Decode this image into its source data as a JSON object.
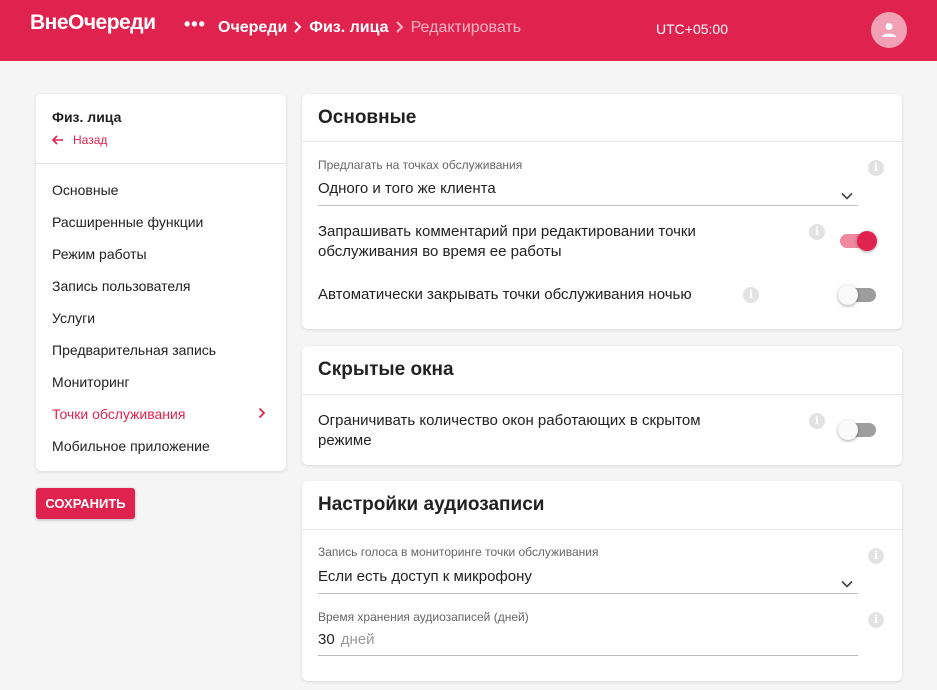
{
  "header": {
    "logo": "ВнеОчереди",
    "more_icon": "•••",
    "breadcrumbs": [
      "Очереди",
      "Физ. лица",
      "Редактировать"
    ],
    "timezone": "UTC+05:00",
    "accent_color": "#e0234e"
  },
  "sidebar": {
    "title": "Физ. лица",
    "back_label": "Назад",
    "items": [
      {
        "label": "Основные"
      },
      {
        "label": "Расширенные функции"
      },
      {
        "label": "Режим работы"
      },
      {
        "label": "Запись пользователя"
      },
      {
        "label": "Услуги"
      },
      {
        "label": "Предварительная запись"
      },
      {
        "label": "Мониторинг"
      },
      {
        "label": "Точки обслуживания",
        "active": true
      },
      {
        "label": "Мобильное приложение"
      }
    ],
    "save_label": "СОХРАНИТЬ"
  },
  "main": {
    "basic": {
      "title": "Основные",
      "offer_label": "Предлагать на точках обслуживания",
      "offer_value": "Одного и того же клиента",
      "ask_comment_label": "Запрашивать комментарий при редактировании точки обслуживания во время ее работы",
      "ask_comment_enabled": true,
      "auto_close_label": "Автоматически закрывать точки обслуживания ночью",
      "auto_close_enabled": false
    },
    "hidden": {
      "title": "Скрытые окна",
      "limit_label": "Ограничивать количество окон работающих в скрытом режиме",
      "limit_enabled": false
    },
    "audio": {
      "title": "Настройки аудиозаписи",
      "voice_label": "Запись голоса в мониторинге точки обслуживания",
      "voice_value": "Если есть доступ к микрофону",
      "retention_label": "Время хранения аудиозаписей (дней)",
      "retention_value": "30",
      "retention_unit": "дней"
    }
  }
}
